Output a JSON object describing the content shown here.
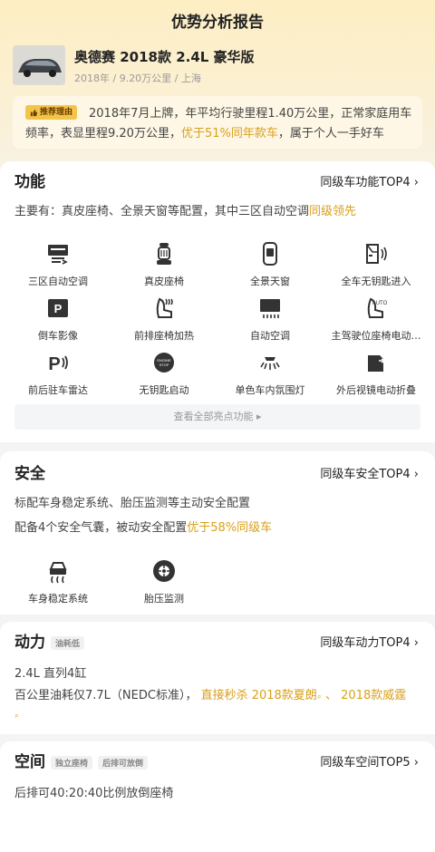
{
  "page": {
    "title": "优势分析报告"
  },
  "car": {
    "name": "奥德赛 2018款 2.4L 豪华版",
    "meta": "2018年 / 9.20万公里 / 上海"
  },
  "reason": {
    "tag": "推荐理由",
    "text_before": "2018年7月上牌，年平均行驶里程1.40万公里，正常家庭用车频率，表显里程9.20万公里，",
    "highlight": "优于51%同年款车",
    "text_after": "，属于个人一手好车"
  },
  "function": {
    "title": "功能",
    "link": "同级车功能TOP4",
    "desc_before": "主要有：真皮座椅、全景天窗等配置，其中三区自动空调",
    "desc_highlight": "同级领先",
    "features": [
      {
        "label": "三区自动空调",
        "icon": "climate-icon"
      },
      {
        "label": "真皮座椅",
        "icon": "seat-icon"
      },
      {
        "label": "全景天窗",
        "icon": "sunroof-icon"
      },
      {
        "label": "全车无钥匙进入",
        "icon": "keyless-entry-icon"
      },
      {
        "label": "倒车影像",
        "icon": "reverse-camera-icon"
      },
      {
        "label": "前排座椅加热",
        "icon": "seat-heating-icon"
      },
      {
        "label": "自动空调",
        "icon": "auto-ac-icon"
      },
      {
        "label": "主驾驶位座椅电动…",
        "icon": "power-seat-icon"
      },
      {
        "label": "前后驻车雷达",
        "icon": "parking-radar-icon"
      },
      {
        "label": "无钥匙启动",
        "icon": "keyless-start-icon"
      },
      {
        "label": "单色车内氛围灯",
        "icon": "ambient-light-icon"
      },
      {
        "label": "外后视镜电动折叠",
        "icon": "mirror-fold-icon"
      }
    ],
    "more": "查看全部亮点功能"
  },
  "safety": {
    "title": "安全",
    "link": "同级车安全TOP4",
    "line1": "标配车身稳定系统、胎压监测等主动安全配置",
    "line2_before": "配备4个安全气囊，被动安全配置",
    "line2_highlight": "优于58%同级车",
    "features": [
      {
        "label": "车身稳定系统",
        "icon": "stability-icon"
      },
      {
        "label": "胎压监测",
        "icon": "tire-pressure-icon"
      }
    ]
  },
  "power": {
    "title": "动力",
    "tag": "油耗低",
    "link": "同级车动力TOP4",
    "engine": "2.4L 直列4缸",
    "fuel_before": "百公里油耗仅7.7L（NEDC标准），",
    "fuel_highlight": "直接秒杀 2018款夏朗",
    "fuel_sep": "、",
    "fuel_highlight2": "2018款威霆"
  },
  "space": {
    "title": "空间",
    "tag1": "独立座椅",
    "tag2": "后排可放倒",
    "link": "同级车空间TOP5",
    "desc": "后排可40:20:40比例放倒座椅"
  },
  "colors": {
    "accent": "#d9a01a",
    "tag_bg": "#f3c44a",
    "hero": "#fdeec3"
  }
}
